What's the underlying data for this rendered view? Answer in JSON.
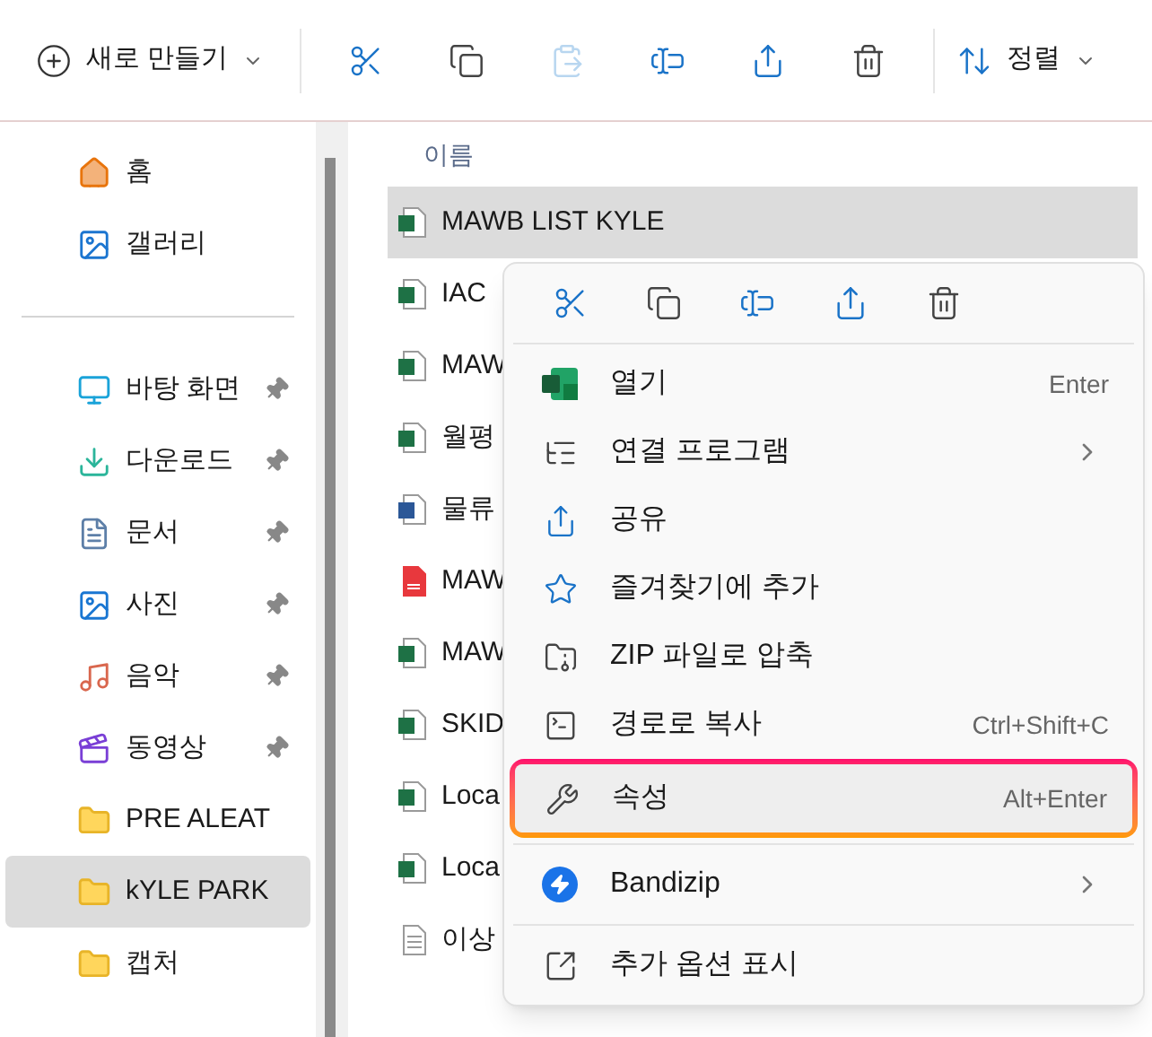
{
  "toolbar": {
    "new_label": "새로 만들기",
    "actions": [
      {
        "kind": "cut",
        "disabled": false
      },
      {
        "kind": "copy",
        "disabled": false
      },
      {
        "kind": "paste",
        "disabled": true
      },
      {
        "kind": "rename",
        "disabled": false
      },
      {
        "kind": "share",
        "disabled": false
      },
      {
        "kind": "delete",
        "disabled": false
      }
    ],
    "sort_label": "정렬"
  },
  "sidebar": {
    "top_items": [
      {
        "kind": "home",
        "label": "홈",
        "pinned": false,
        "selected": false
      },
      {
        "kind": "gallery",
        "label": "갤러리",
        "pinned": false,
        "selected": false
      }
    ],
    "items": [
      {
        "kind": "desktop",
        "label": "바탕 화면",
        "pinned": true,
        "selected": false
      },
      {
        "kind": "download",
        "label": "다운로드",
        "pinned": true,
        "selected": false
      },
      {
        "kind": "documents",
        "label": "문서",
        "pinned": true,
        "selected": false
      },
      {
        "kind": "pictures",
        "label": "사진",
        "pinned": true,
        "selected": false
      },
      {
        "kind": "music",
        "label": "음악",
        "pinned": true,
        "selected": false
      },
      {
        "kind": "videos",
        "label": "동영상",
        "pinned": true,
        "selected": false
      },
      {
        "kind": "folder",
        "label": "PRE ALEAT",
        "pinned": false,
        "selected": false
      },
      {
        "kind": "folder",
        "label": "kYLE PARK",
        "pinned": false,
        "selected": true
      },
      {
        "kind": "folder",
        "label": "캡처",
        "pinned": false,
        "selected": false
      }
    ]
  },
  "file_list": {
    "column_header": "이름",
    "rows": [
      {
        "kind": "excel",
        "name": "MAWB LIST KYLE",
        "selected": true
      },
      {
        "kind": "excel",
        "name": "IAC",
        "selected": false
      },
      {
        "kind": "excel",
        "name": "MAW",
        "selected": false
      },
      {
        "kind": "excel",
        "name": "월평",
        "selected": false
      },
      {
        "kind": "word",
        "name": "물류",
        "selected": false
      },
      {
        "kind": "pdf",
        "name": "MAW",
        "selected": false
      },
      {
        "kind": "excel",
        "name": "MAW",
        "selected": false
      },
      {
        "kind": "excel",
        "name": "SKID",
        "selected": false
      },
      {
        "kind": "excel",
        "name": "Loca",
        "selected": false
      },
      {
        "kind": "excel",
        "name": "Loca",
        "selected": false
      },
      {
        "kind": "text",
        "name": "이상",
        "selected": false
      }
    ]
  },
  "context_menu": {
    "actions": [
      {
        "kind": "cut"
      },
      {
        "kind": "copy"
      },
      {
        "kind": "rename"
      },
      {
        "kind": "share"
      },
      {
        "kind": "delete"
      }
    ],
    "sections": [
      [
        {
          "kind": "excel",
          "label": "열기",
          "shortcut": "Enter",
          "submenu": false,
          "highlighted": false
        },
        {
          "kind": "open-with",
          "label": "연결 프로그램",
          "submenu": true,
          "highlighted": false
        },
        {
          "kind": "share",
          "label": "공유",
          "submenu": false,
          "highlighted": false
        },
        {
          "kind": "star",
          "label": "즐겨찾기에 추가",
          "submenu": false,
          "highlighted": false
        },
        {
          "kind": "zip",
          "label": "ZIP 파일로 압축",
          "submenu": false,
          "highlighted": false
        },
        {
          "kind": "path",
          "label": "경로로 복사",
          "shortcut": "Ctrl+Shift+C",
          "submenu": false,
          "highlighted": false
        },
        {
          "kind": "wrench",
          "label": "속성",
          "shortcut": "Alt+Enter",
          "submenu": false,
          "highlighted": true
        }
      ],
      [
        {
          "kind": "bandizip",
          "label": "Bandizip",
          "submenu": true,
          "highlighted": false
        }
      ],
      [
        {
          "kind": "more",
          "label": "추가 옵션 표시",
          "submenu": false,
          "highlighted": false
        }
      ]
    ]
  }
}
